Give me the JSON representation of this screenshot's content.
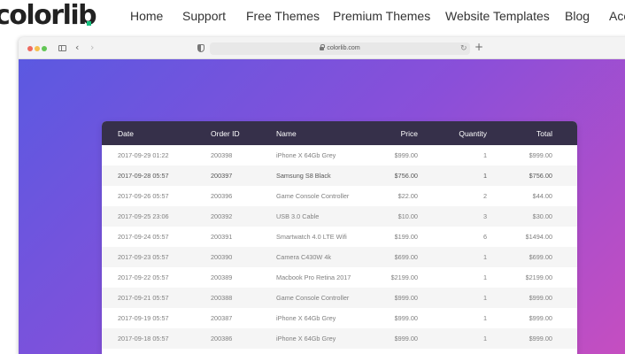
{
  "site": {
    "logo": "colorlib",
    "nav": [
      "Home",
      "Support",
      "Free Themes",
      "Premium Themes",
      "Website Templates",
      "Blog",
      "Acc"
    ]
  },
  "browser": {
    "url": "colorlib.com",
    "back_icon": "‹",
    "forward_icon": "›",
    "new_tab_icon": "+",
    "reload_icon": "↻"
  },
  "table": {
    "headers": {
      "date": "Date",
      "order_id": "Order ID",
      "name": "Name",
      "price": "Price",
      "quantity": "Quantity",
      "total": "Total"
    },
    "rows": [
      {
        "date": "2017-09-29 01:22",
        "order_id": "200398",
        "name": "iPhone X 64Gb Grey",
        "price": "$999.00",
        "quantity": "1",
        "total": "$999.00"
      },
      {
        "date": "2017-09-28 05:57",
        "order_id": "200397",
        "name": "Samsung S8 Black",
        "price": "$756.00",
        "quantity": "1",
        "total": "$756.00"
      },
      {
        "date": "2017-09-26 05:57",
        "order_id": "200396",
        "name": "Game Console Controller",
        "price": "$22.00",
        "quantity": "2",
        "total": "$44.00"
      },
      {
        "date": "2017-09-25 23:06",
        "order_id": "200392",
        "name": "USB 3.0 Cable",
        "price": "$10.00",
        "quantity": "3",
        "total": "$30.00"
      },
      {
        "date": "2017-09-24 05:57",
        "order_id": "200391",
        "name": "Smartwatch 4.0 LTE Wifi",
        "price": "$199.00",
        "quantity": "6",
        "total": "$1494.00"
      },
      {
        "date": "2017-09-23 05:57",
        "order_id": "200390",
        "name": "Camera C430W 4k",
        "price": "$699.00",
        "quantity": "1",
        "total": "$699.00"
      },
      {
        "date": "2017-09-22 05:57",
        "order_id": "200389",
        "name": "Macbook Pro Retina 2017",
        "price": "$2199.00",
        "quantity": "1",
        "total": "$2199.00"
      },
      {
        "date": "2017-09-21 05:57",
        "order_id": "200388",
        "name": "Game Console Controller",
        "price": "$999.00",
        "quantity": "1",
        "total": "$999.00"
      },
      {
        "date": "2017-09-19 05:57",
        "order_id": "200387",
        "name": "iPhone X 64Gb Grey",
        "price": "$999.00",
        "quantity": "1",
        "total": "$999.00"
      },
      {
        "date": "2017-09-18 05:57",
        "order_id": "200386",
        "name": "iPhone X 64Gb Grey",
        "price": "$999.00",
        "quantity": "1",
        "total": "$999.00"
      }
    ]
  },
  "colors": {
    "header_bg": "#36304a",
    "gradient_start": "#5b59e1",
    "gradient_end": "#c64ec0",
    "logo_dot": "#16c17f"
  }
}
